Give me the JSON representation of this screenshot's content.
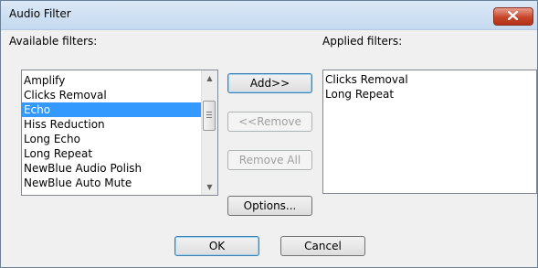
{
  "window": {
    "title": "Audio Filter"
  },
  "available": {
    "label": "Available filters:",
    "items": [
      "Amplify",
      "Clicks Removal",
      "Echo",
      "Hiss Reduction",
      "Long Echo",
      "Long Repeat",
      "NewBlue Audio Polish",
      "NewBlue Auto Mute"
    ],
    "selected_index": 2
  },
  "applied": {
    "label": "Applied filters:",
    "items": [
      "Clicks Removal",
      "Long Repeat"
    ]
  },
  "buttons": {
    "add": "Add>>",
    "remove": "<<Remove",
    "remove_all": "Remove All",
    "options": "Options...",
    "ok": "OK",
    "cancel": "Cancel"
  },
  "icons": {
    "close": "close-icon",
    "scroll_up": "scroll-up-arrow-icon",
    "scroll_down": "scroll-down-arrow-icon"
  },
  "colors": {
    "selection": "#3399ff",
    "close_button": "#c7452a"
  }
}
